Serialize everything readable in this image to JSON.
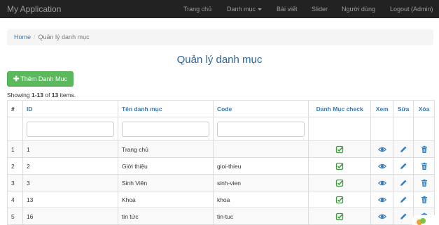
{
  "navbar": {
    "brand": "My Application",
    "items": [
      {
        "label": "Trang chủ"
      },
      {
        "label": "Danh mục"
      },
      {
        "label": "Bài viết"
      },
      {
        "label": "Slider"
      },
      {
        "label": "Người dùng"
      },
      {
        "label": "Logout (Admin)"
      }
    ]
  },
  "breadcrumb": {
    "home": "Home",
    "separator": "/",
    "current": "Quản lý danh mục"
  },
  "page": {
    "title": "Quản lý danh mục",
    "add_button_label": "Thêm Danh Muc",
    "summary": {
      "prefix": "Showing ",
      "range": "1-13",
      "middle": " of ",
      "total": "13",
      "suffix": " items."
    }
  },
  "table": {
    "headers": [
      "#",
      "ID",
      "Tên danh mục",
      "Code",
      "Danh Mục check",
      "Xem",
      "Sửa",
      "Xóa"
    ],
    "filters": {
      "id": "",
      "ten_danh_muc": "",
      "code": ""
    },
    "rows": [
      {
        "num": "1",
        "id": "1",
        "name": "Trang chủ",
        "code": ""
      },
      {
        "num": "2",
        "id": "2",
        "name": "Giới thiệu",
        "code": "gioi-thieu"
      },
      {
        "num": "3",
        "id": "3",
        "name": "Sinh Viên",
        "code": "sinh-vien"
      },
      {
        "num": "4",
        "id": "13",
        "name": "Khoa",
        "code": "khoa"
      },
      {
        "num": "5",
        "id": "16",
        "name": "tin tức",
        "code": "tin-tuc"
      }
    ]
  },
  "icons": {
    "add": "plus-icon",
    "check": "check-square-icon",
    "view": "eye-icon",
    "edit": "pencil-icon",
    "delete": "trash-icon"
  },
  "colors": {
    "navbar_bg": "#222222",
    "link": "#337ab7",
    "title": "#2a6496",
    "success": "#5cb85c",
    "check_icon": "#3c9a3c"
  }
}
